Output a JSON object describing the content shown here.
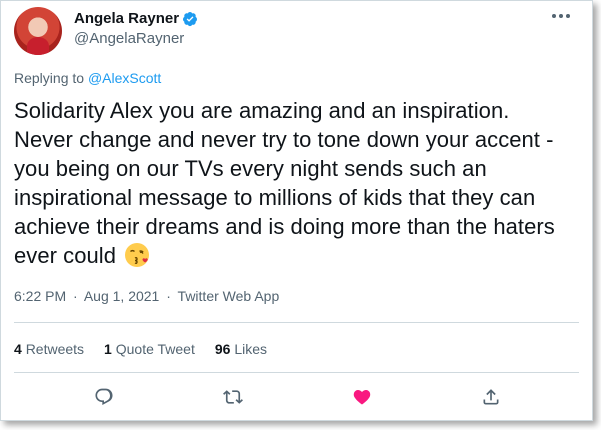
{
  "author": {
    "display_name": "Angela Rayner",
    "handle": "@AngelaRayner",
    "verified_color": "#1d9bf0"
  },
  "reply": {
    "prefix": "Replying to ",
    "to": "@AlexScott"
  },
  "tweet": {
    "text": "Solidarity Alex you are amazing and an inspiration.\nNever change and never try to tone down your accent -\nyou being on our TVs every night sends such an\ninspirational message to millions of kids that they can\nachieve their dreams and is doing more than the haters\never could",
    "emoji": "face-blowing-a-kiss"
  },
  "meta": {
    "time": "6:22 PM",
    "date": "Aug 1, 2021",
    "source": "Twitter Web App",
    "separator": "·"
  },
  "stats": {
    "retweets_count": "4",
    "retweets_label": "Retweets",
    "quotes_count": "1",
    "quotes_label": "Quote Tweet",
    "likes_count": "96",
    "likes_label": "Likes"
  },
  "actions": {
    "reply_icon": "reply-icon",
    "retweet_icon": "retweet-icon",
    "like_icon": "heart-icon",
    "like_color": "#f91880",
    "share_icon": "share-icon"
  }
}
